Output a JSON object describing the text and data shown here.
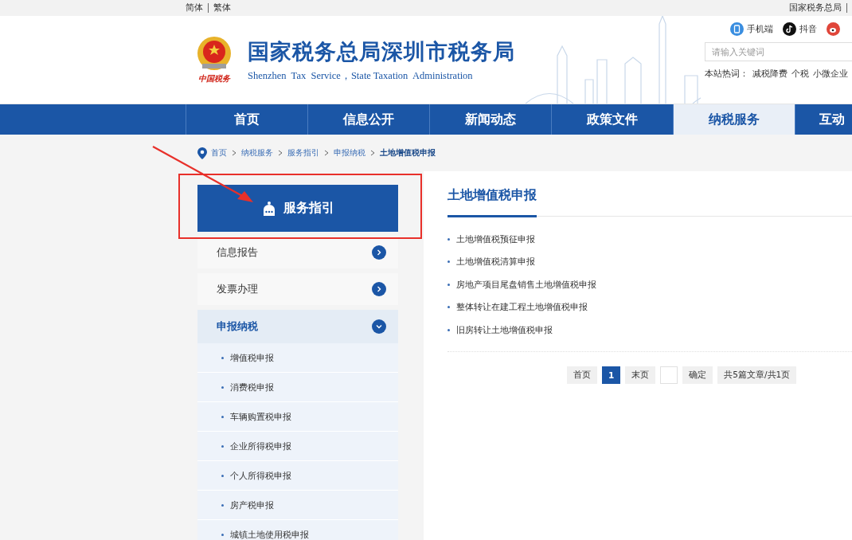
{
  "top_bar": {
    "languages": [
      "简体",
      "繁体"
    ],
    "right_link": "国家税务总局"
  },
  "header": {
    "logo_caption": "中国税务",
    "title": "国家税务总局深圳市税务局",
    "subtitle": "Shenzhen  Tax  Service，State Taxation  Administration",
    "shortcuts": [
      {
        "kind": "phone",
        "label": "手机端"
      },
      {
        "kind": "tiktok",
        "label": "抖音"
      },
      {
        "kind": "weibo"
      }
    ],
    "search": {
      "placeholder": "请输入关键词"
    },
    "hot_words_label": "本站热词：",
    "hot_words": [
      "减税降费",
      "个税",
      "小微企业"
    ]
  },
  "nav": [
    {
      "label": "首页",
      "selected": false
    },
    {
      "label": "信息公开",
      "selected": false
    },
    {
      "label": "新闻动态",
      "selected": false
    },
    {
      "label": "政策文件",
      "selected": false
    },
    {
      "label": "纳税服务",
      "selected": true
    },
    {
      "label": "互动",
      "selected": false
    }
  ],
  "breadcrumb": [
    "首页",
    "纳税服务",
    "服务指引",
    "申报纳税",
    "土地增值税申报"
  ],
  "sidebar": {
    "heading": "服务指引",
    "items": [
      {
        "label": "信息报告",
        "expanded": false
      },
      {
        "label": "发票办理",
        "expanded": false
      },
      {
        "label": "申报纳税",
        "expanded": true,
        "children": [
          "增值税申报",
          "消费税申报",
          "车辆购置税申报",
          "企业所得税申报",
          "个人所得税申报",
          "房产税申报",
          "城镇土地使用税申报"
        ]
      }
    ]
  },
  "content": {
    "title": "土地增值税申报",
    "articles": [
      "土地增值税预征申报",
      "土地增值税清算申报",
      "房地产项目尾盘销售土地增值税申报",
      "整体转让在建工程土地增值税申报",
      "旧房转让土地增值税申报"
    ],
    "pagination": {
      "first": "首页",
      "pages": [
        {
          "label": "1",
          "selected": true
        }
      ],
      "last": "末页",
      "confirm": "确定",
      "summary": "共5篇文章/共1页"
    }
  }
}
